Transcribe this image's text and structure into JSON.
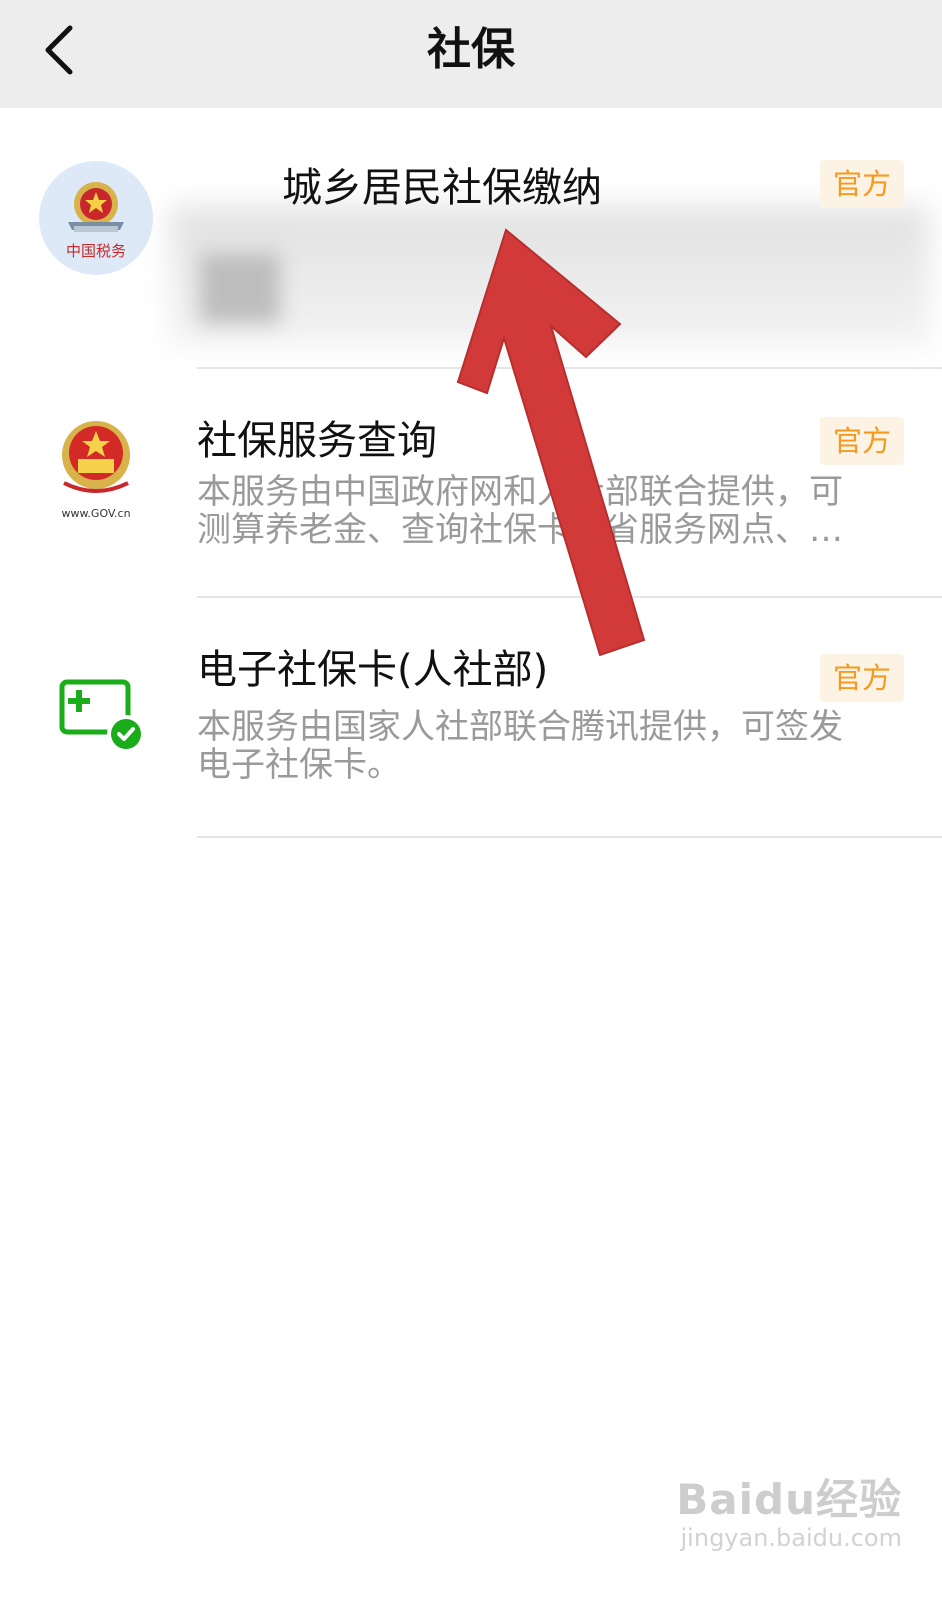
{
  "header": {
    "title": "社保",
    "back_icon": "chevron-left-icon"
  },
  "results": [
    {
      "icon": "tax-emblem-icon",
      "icon_text": "中国税务",
      "title": "城乡居民社保缴纳",
      "badge": "官方",
      "description": [
        "",
        ""
      ]
    },
    {
      "icon": "gov-emblem-icon",
      "icon_text": "www.GOV.cn",
      "title": "社保服务查询",
      "badge": "官方",
      "description": [
        "本服务由中国政府网和人社部联合提供，可",
        "测算养老金、查询社保卡跨省服务网点、…"
      ]
    },
    {
      "icon": "social-security-card-icon",
      "title": "电子社保卡(人社部)",
      "badge": "官方",
      "description": [
        "本服务由国家人社部联合腾讯提供，可签发",
        "电子社保卡。"
      ]
    }
  ],
  "colors": {
    "header_bg": "#ededed",
    "badge_bg": "#fdf3e5",
    "badge_text": "#f59a1f",
    "arrow": "#d23a3a",
    "card_icon_green": "#1aad19"
  },
  "watermark": {
    "main": "Baidu经验",
    "sub": "jingyan.baidu.com"
  }
}
